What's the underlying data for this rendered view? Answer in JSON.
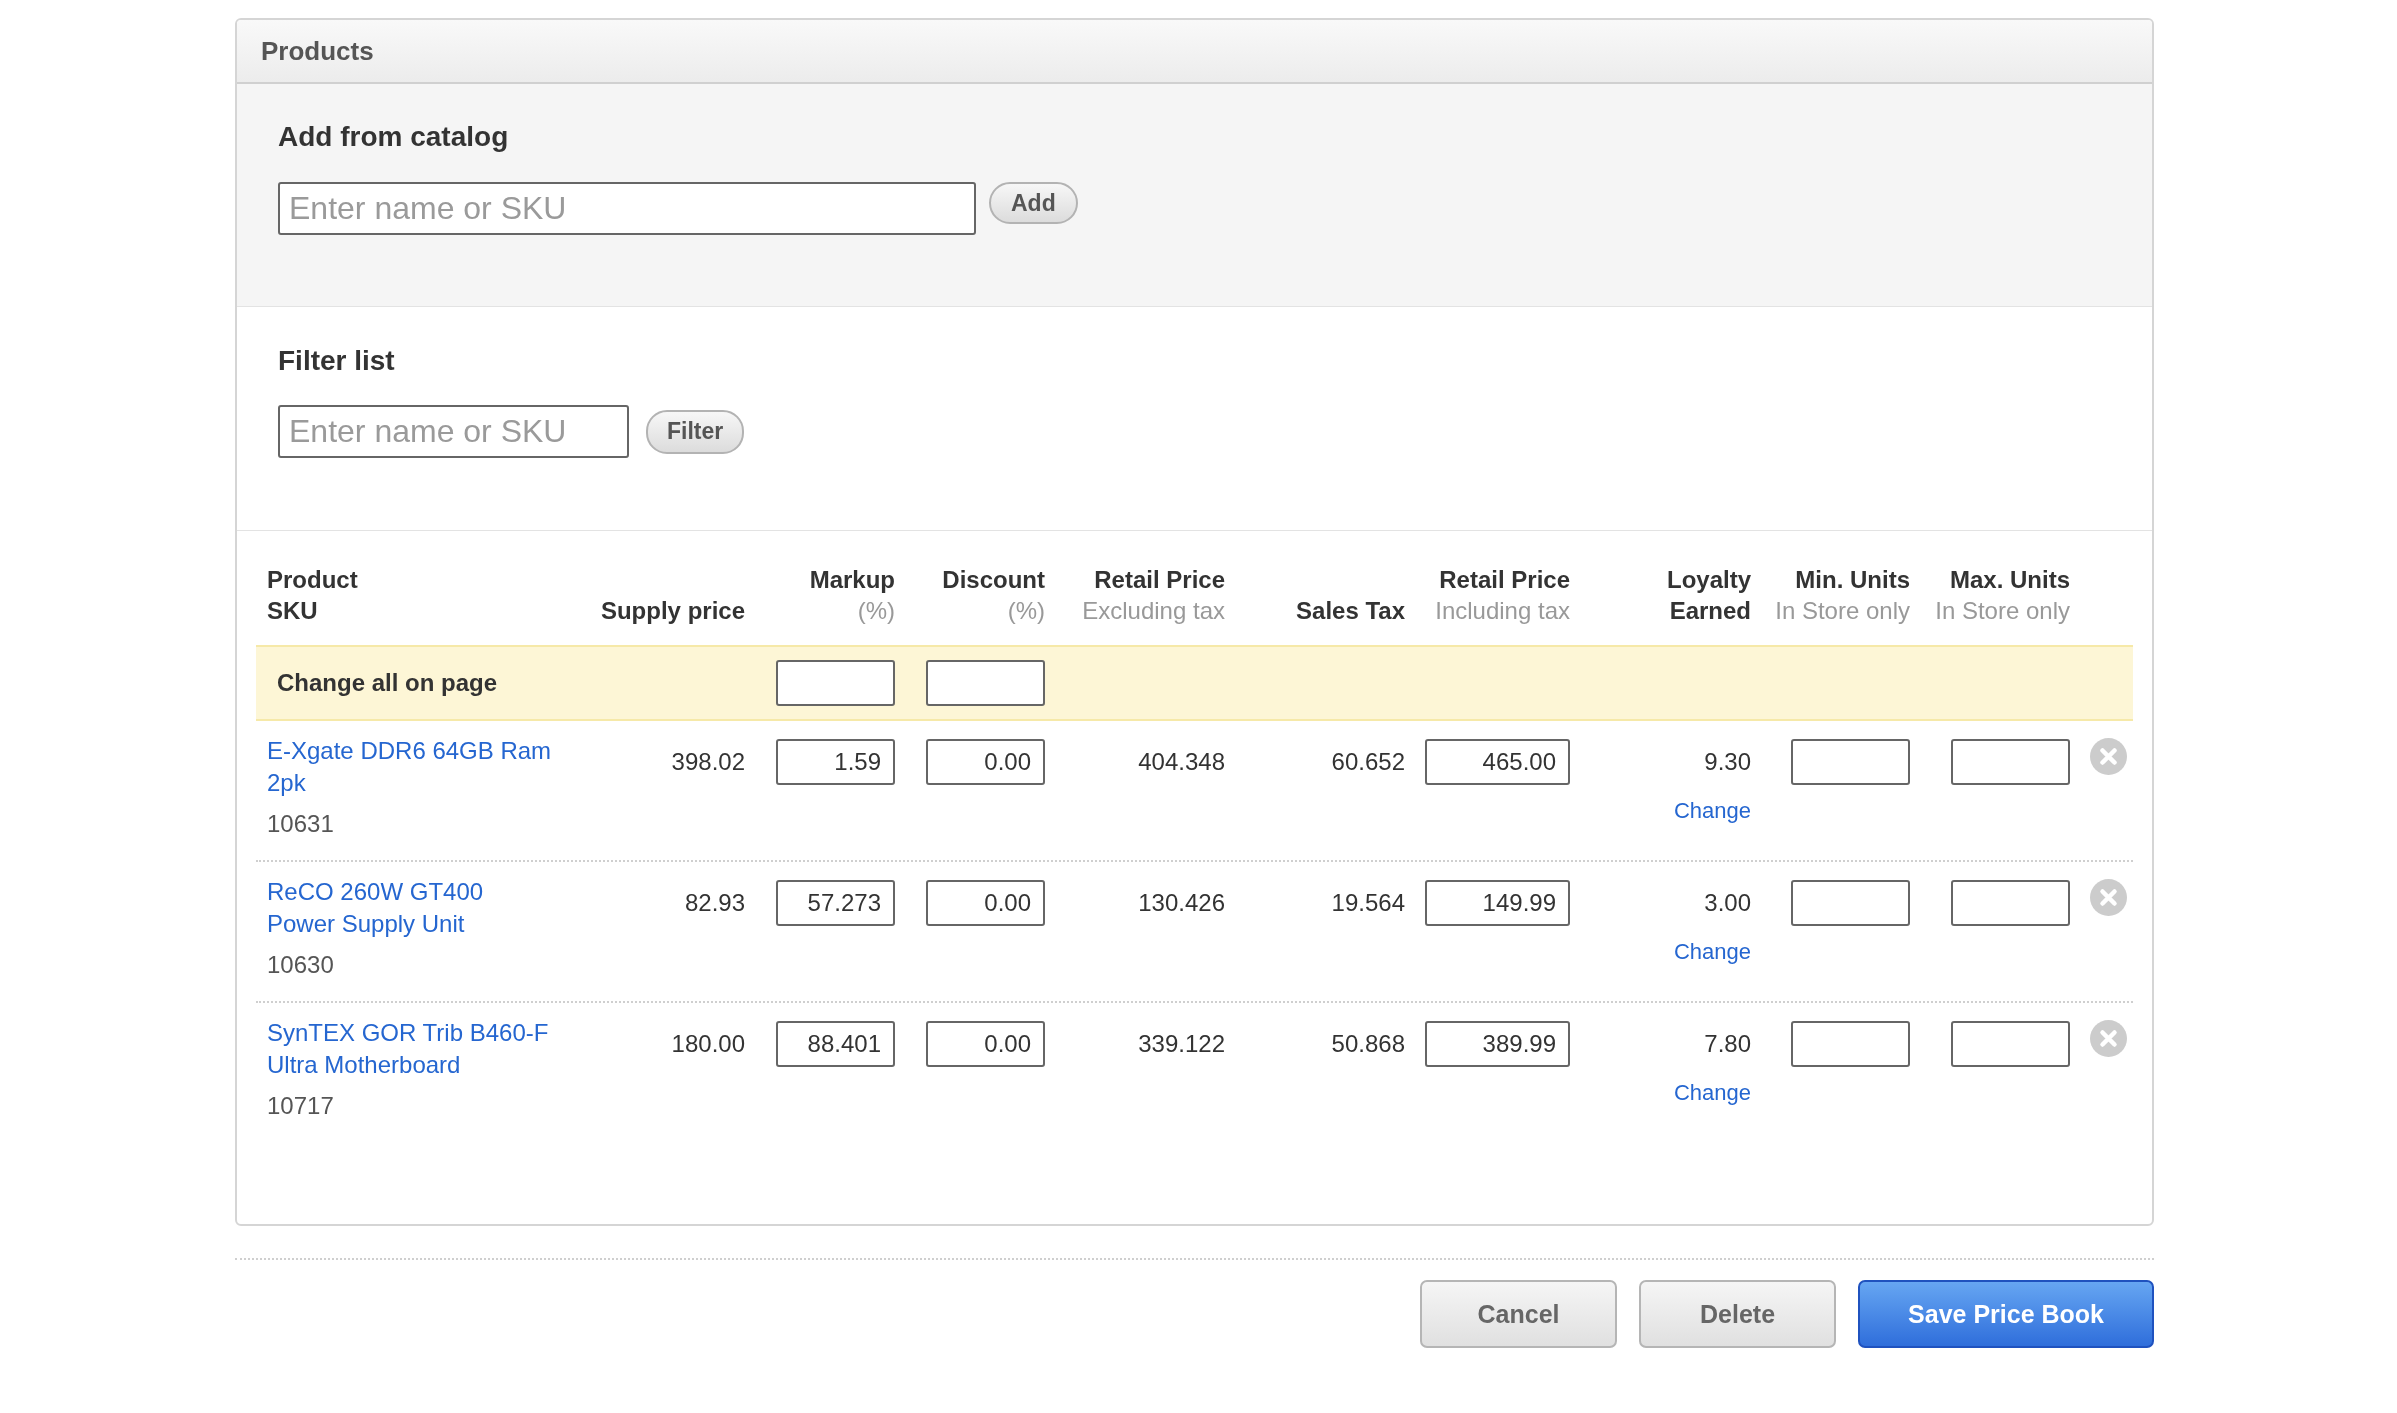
{
  "panel": {
    "title": "Products",
    "add_from_catalog": {
      "heading": "Add from catalog",
      "search": {
        "placeholder": "Enter name or SKU"
      },
      "button": "Add"
    },
    "filter_list": {
      "heading": "Filter list",
      "search": {
        "placeholder": "Enter name or SKU"
      },
      "button": "Filter"
    },
    "table": {
      "columns": [
        {
          "lines": [
            {
              "text": "Product",
              "kind": "title"
            },
            {
              "text": "SKU",
              "kind": "title"
            }
          ]
        },
        {
          "lines": [
            {
              "text": "Supply price",
              "kind": "title"
            }
          ]
        },
        {
          "lines": [
            {
              "text": "Markup",
              "kind": "title"
            },
            {
              "text": "(%)",
              "kind": "note"
            }
          ]
        },
        {
          "lines": [
            {
              "text": "Discount",
              "kind": "title"
            },
            {
              "text": "(%)",
              "kind": "note"
            }
          ]
        },
        {
          "lines": [
            {
              "text": "Retail Price",
              "kind": "title"
            },
            {
              "text": "Excluding tax",
              "kind": "note"
            }
          ]
        },
        {
          "lines": [
            {
              "text": "Sales Tax",
              "kind": "title"
            }
          ]
        },
        {
          "lines": [
            {
              "text": "Retail Price",
              "kind": "title"
            },
            {
              "text": "Including tax",
              "kind": "note"
            }
          ]
        },
        {
          "lines": [
            {
              "text": "Loyalty",
              "kind": "title"
            },
            {
              "text": "Earned",
              "kind": "title"
            }
          ]
        },
        {
          "lines": [
            {
              "text": "Min. Units",
              "kind": "title"
            },
            {
              "text": "In Store only",
              "kind": "note"
            }
          ]
        },
        {
          "lines": [
            {
              "text": "Max. Units",
              "kind": "title"
            },
            {
              "text": "In Store only",
              "kind": "note"
            }
          ]
        }
      ],
      "change_all": {
        "label": "Change all on page"
      },
      "rows": [
        {
          "name": "E-Xgate DDR6 64GB Ram 2pk",
          "sku": "10631",
          "supply_price": "398.02",
          "markup": "1.59",
          "discount": "0.00",
          "retail_price_excl_tax": "404.348",
          "sales_tax": "60.652",
          "retail_price_incl_tax": "465.00",
          "loyalty": "9.30",
          "loyalty_link": "Change"
        },
        {
          "name": "ReCO 260W GT400 Power Supply Unit",
          "sku": "10630",
          "supply_price": "82.93",
          "markup": "57.273",
          "discount": "0.00",
          "retail_price_excl_tax": "130.426",
          "sales_tax": "19.564",
          "retail_price_incl_tax": "149.99",
          "loyalty": "3.00",
          "loyalty_link": "Change"
        },
        {
          "name": "SynTEX GOR Trib B460-F Ultra Motherboard",
          "sku": "10717",
          "supply_price": "180.00",
          "markup": "88.401",
          "discount": "0.00",
          "retail_price_excl_tax": "339.122",
          "sales_tax": "50.868",
          "retail_price_incl_tax": "389.99",
          "loyalty": "7.80",
          "loyalty_link": "Change"
        }
      ]
    }
  },
  "buttons": [
    {
      "label": "Cancel",
      "kind": "default"
    },
    {
      "label": "Delete",
      "kind": "default"
    },
    {
      "label": "Save Price Book",
      "kind": "primary"
    }
  ]
}
